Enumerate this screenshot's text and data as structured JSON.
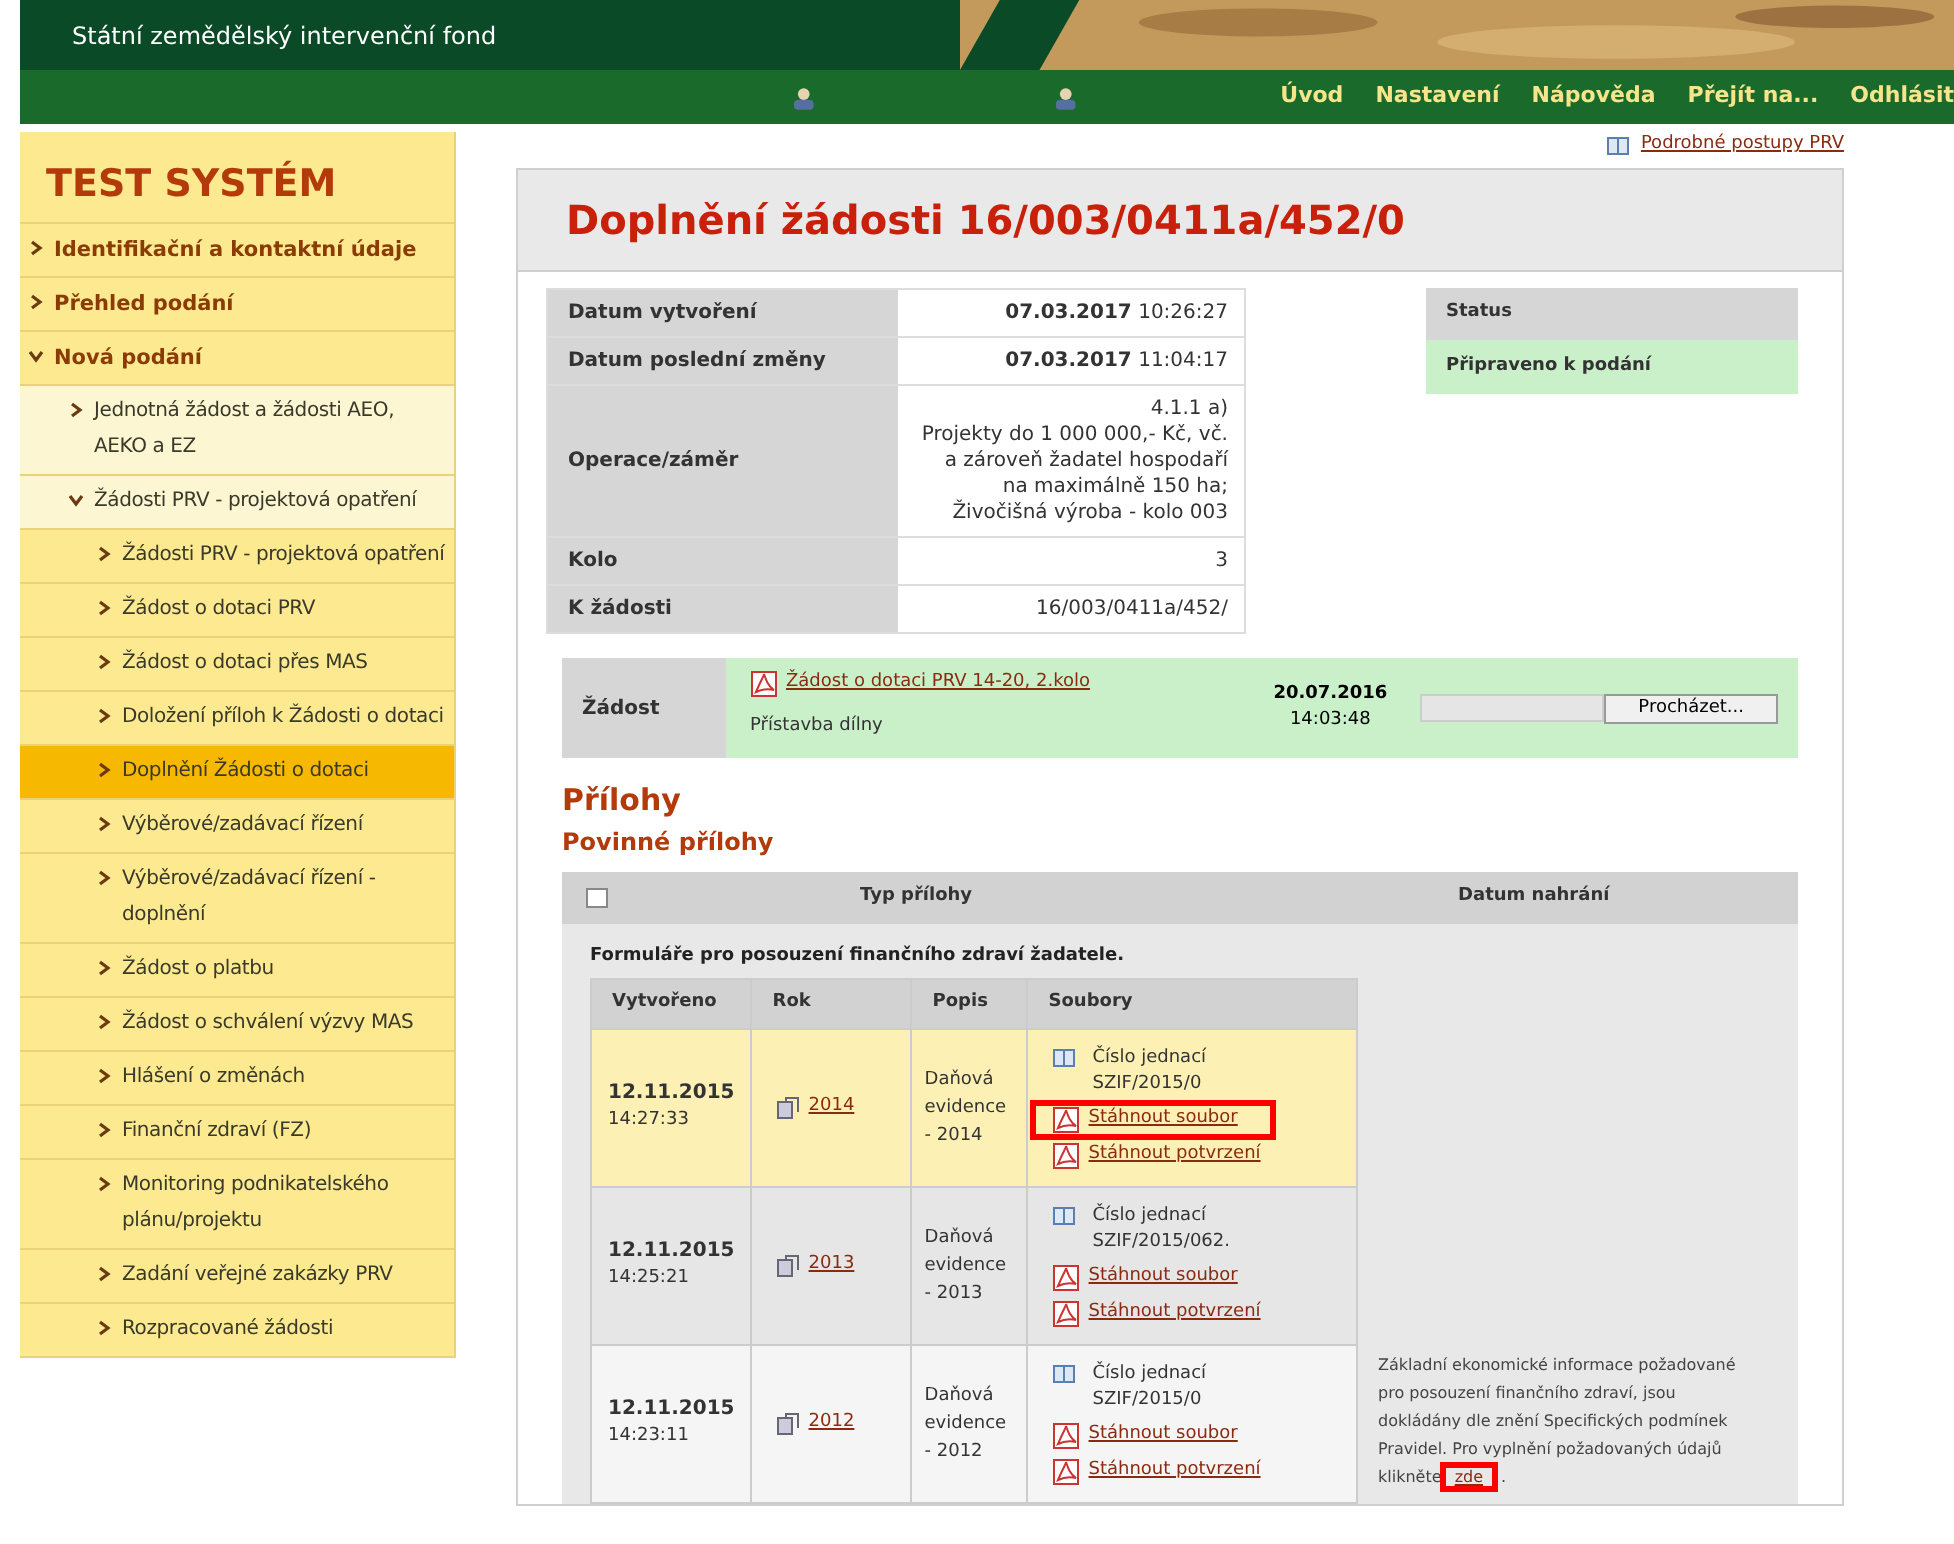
{
  "header": {
    "org_name": "Státní zemědělský intervenční fond"
  },
  "nav": {
    "links": [
      "Úvod",
      "Nastavení",
      "Nápověda",
      "Přejít na...",
      "Odhlásit"
    ]
  },
  "sidebar": {
    "title": "TEST SYSTÉM",
    "items": [
      {
        "label": "Identifikační a kontaktní údaje",
        "expanded": false,
        "selected": false
      },
      {
        "label": "Přehled podání",
        "expanded": false,
        "selected": false
      },
      {
        "label": "Nová podání",
        "expanded": true,
        "selected": false,
        "children": [
          {
            "label": "Jednotná žádost a žádosti AEO, AEKO a EZ",
            "expanded": false,
            "selected": false
          },
          {
            "label": "Žádosti PRV - projektová opatření",
            "expanded": true,
            "selected": false,
            "children": [
              {
                "label": "Žádosti PRV - projektová opatření",
                "expanded": false,
                "selected": false
              },
              {
                "label": "Žádost o dotaci PRV",
                "expanded": false,
                "selected": false
              },
              {
                "label": "Žádost o dotaci přes MAS",
                "expanded": false,
                "selected": false
              },
              {
                "label": "Doložení příloh k Žádosti o dotaci",
                "expanded": false,
                "selected": false
              },
              {
                "label": "Doplnění Žádosti o dotaci",
                "expanded": false,
                "selected": true
              },
              {
                "label": "Výběrové/zadávací řízení",
                "expanded": false,
                "selected": false
              },
              {
                "label": "Výběrové/zadávací řízení - doplnění",
                "expanded": false,
                "selected": false
              },
              {
                "label": "Žádost o platbu",
                "expanded": false,
                "selected": false
              },
              {
                "label": "Žádost o schválení výzvy MAS",
                "expanded": false,
                "selected": false
              },
              {
                "label": "Hlášení o změnách",
                "expanded": false,
                "selected": false
              },
              {
                "label": "Finanční zdraví (FZ)",
                "expanded": false,
                "selected": false
              },
              {
                "label": "Monitoring podnikatelského plánu/projektu",
                "expanded": false,
                "selected": false
              },
              {
                "label": "Zadání veřejné zakázky PRV",
                "expanded": false,
                "selected": false
              },
              {
                "label": "Rozpracované žádosti",
                "expanded": false,
                "selected": false
              }
            ]
          }
        ]
      }
    ]
  },
  "help_link": "Podrobné postupy PRV",
  "page_title": "Doplnění žádosti 16/003/0411a/452/0",
  "details": [
    {
      "label": "Datum vytvoření",
      "date": "07.03.2017",
      "time": "10:26:27"
    },
    {
      "label": "Datum poslední změny",
      "date": "07.03.2017",
      "time": "11:04:17"
    },
    {
      "label": "Operace/záměr",
      "lines": [
        "4.1.1 a)",
        "Projekty do 1 000 000,- Kč, vč.",
        "a zároveň žadatel hospodaří",
        "na maximálně 150 ha;",
        "Živočišná výroba - kolo 003"
      ]
    },
    {
      "label": "Kolo",
      "lines": [
        "3"
      ]
    },
    {
      "label": "K žádosti",
      "lines": [
        "16/003/0411a/452/"
      ]
    }
  ],
  "status": {
    "heading": "Status",
    "value": "Připraveno k podání"
  },
  "application": {
    "label": "Žádost",
    "link": "Žádost o dotaci PRV 14-20, 2.kolo",
    "description": "Přístavba dílny",
    "date": "20.07.2016",
    "time": "14:03:48",
    "browse_button": "Procházet..."
  },
  "attachments": {
    "heading": "Přílohy",
    "subheading": "Povinné přílohy",
    "select_all_checked": false,
    "columns": [
      "Typ přílohy",
      "Datum nahrání"
    ],
    "group_title": "Formuláře pro posouzení finančního zdraví žadatele.",
    "table": {
      "columns": [
        "Vytvořeno",
        "Rok",
        "Popis",
        "Soubory"
      ],
      "rows": [
        {
          "selected": true,
          "date": "12.11.2015",
          "time": "14:27:33",
          "year": "2014",
          "description": "Daňová evidence - 2014",
          "ref_label": "Číslo jednací",
          "ref": "SZIF/2015/0",
          "links": [
            {
              "text": "Stáhnout soubor",
              "highlighted": true
            },
            {
              "text": "Stáhnout potvrzení",
              "highlighted": false
            }
          ]
        },
        {
          "selected": false,
          "date": "12.11.2015",
          "time": "14:25:21",
          "year": "2013",
          "description": "Daňová evidence - 2013",
          "ref_label": "Číslo jednací",
          "ref": "SZIF/2015/062.",
          "links": [
            {
              "text": "Stáhnout soubor",
              "highlighted": false
            },
            {
              "text": "Stáhnout potvrzení",
              "highlighted": false
            }
          ]
        },
        {
          "selected": false,
          "date": "12.11.2015",
          "time": "14:23:11",
          "year": "2012",
          "description": "Daňová evidence - 2012",
          "ref_label": "Číslo jednací",
          "ref": "SZIF/2015/0",
          "links": [
            {
              "text": "Stáhnout soubor",
              "highlighted": false
            },
            {
              "text": "Stáhnout potvrzení",
              "highlighted": false
            }
          ]
        }
      ]
    },
    "note": "Základní ekonomické informace požadované pro posouzení finančního zdraví, jsou dokládány dle znění Specifických podmínek Pravidel. Pro vyplnění požadovaných údajů klikněte",
    "note_link": {
      "text": "zde",
      "highlighted": true
    },
    "note_end": "."
  }
}
